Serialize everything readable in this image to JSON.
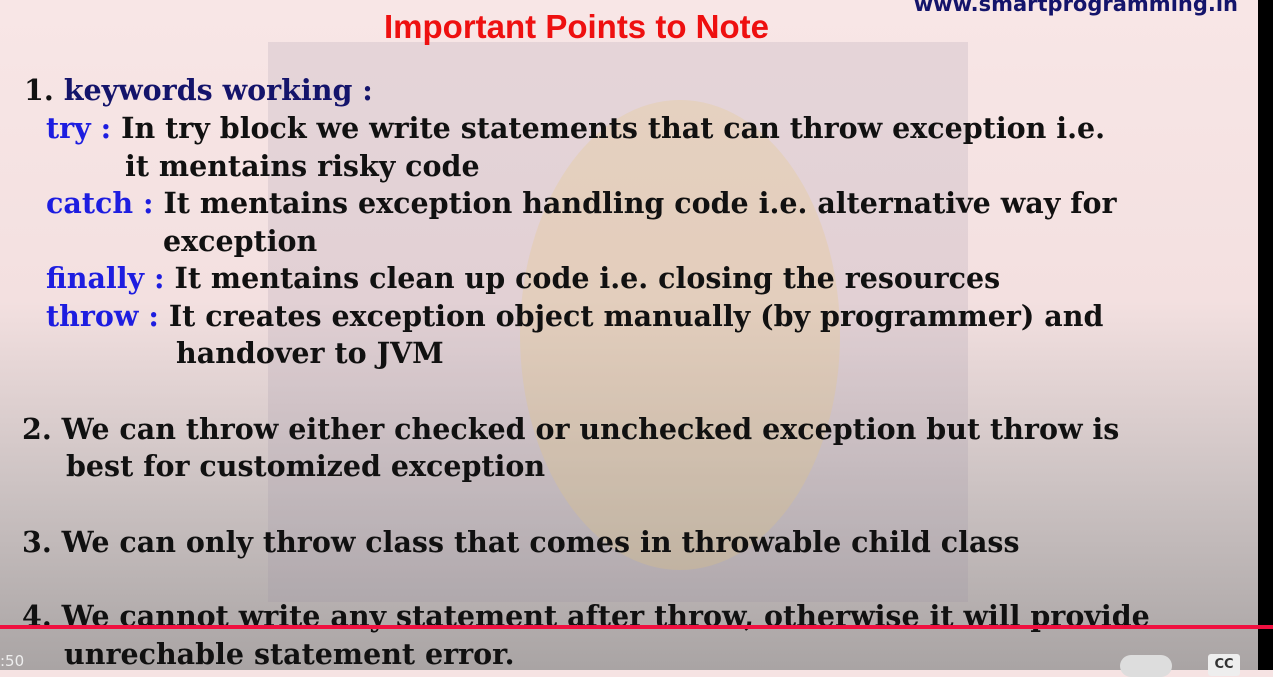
{
  "website": "www.smartprogramming.in",
  "title": "Important Points to Note",
  "points": {
    "p1_num": "1.",
    "p1_head": "keywords working :",
    "try_kw": "try :",
    "try_l1": "In try block we write statements that can throw exception i.e.",
    "try_l2": "it mentains risky code",
    "catch_kw": "catch :",
    "catch_l1": "It mentains exception handling code i.e. alternative way for",
    "catch_l2": "exception",
    "finally_kw": "finally :",
    "finally_l1": "It mentains clean up code i.e. closing the resources",
    "throw_kw": "throw :",
    "throw_l1": "It creates exception object manually (by programmer) and",
    "throw_l2": "handover to JVM",
    "p2_l1": "2. We can throw either checked or unchecked exception but throw is",
    "p2_l2": "best for customized exception",
    "p3": "3. We can only throw class that comes in throwable child class",
    "p4_l1": "4. We cannot write any statement after throw, otherwise it will provide",
    "p4_l2": "unrechable statement error."
  },
  "player": {
    "time": ":50",
    "cc_label": "CC",
    "progress_percent": 100,
    "accent": "#f01040"
  }
}
